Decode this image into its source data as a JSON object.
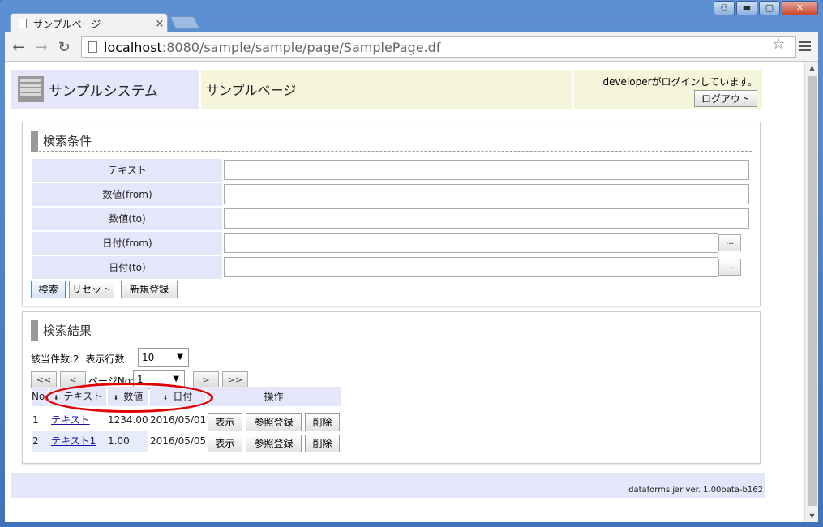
{
  "browser": {
    "tab_title": "サンプルページ",
    "close_glyph": "×",
    "url_host": "localhost",
    "url_path": ":8080/sample/sample/page/SamplePage.df",
    "window_buttons": [
      "⚇",
      "▬",
      "▢",
      "✕"
    ]
  },
  "header": {
    "system_name": "サンプルシステム",
    "page_name": "サンプルページ",
    "login_message": "developerがログインしています。",
    "logout_label": "ログアウト"
  },
  "search": {
    "title": "検索条件",
    "fields": [
      {
        "label": "テキスト",
        "value": ""
      },
      {
        "label": "数値(from)",
        "value": ""
      },
      {
        "label": "数値(to)",
        "value": ""
      },
      {
        "label": "日付(from)",
        "value": "",
        "picker": "..."
      },
      {
        "label": "日付(to)",
        "value": "",
        "picker": "..."
      }
    ],
    "buttons": {
      "search": "検索",
      "reset": "リセット",
      "new": "新規登録"
    }
  },
  "results": {
    "title": "検索結果",
    "count_label": "該当件数:2",
    "rows_label": "表示行数:",
    "rows_value": "10",
    "page_label": "ページNo:",
    "page_value": "1",
    "pager": {
      "first": "<<",
      "prev": "<",
      "next": ">",
      "last": ">>"
    },
    "columns": {
      "no": "No",
      "text": "テキスト",
      "number": "数値",
      "date": "日付",
      "ops": "操作"
    },
    "sort_glyph": "⬍",
    "rows": [
      {
        "no": "1",
        "text": "テキスト",
        "number": "1234.00",
        "date": "2016/05/01",
        "view": "表示",
        "ref": "参照登録",
        "del": "削除"
      },
      {
        "no": "2",
        "text": "テキスト1",
        "number": "1.00",
        "date": "2016/05/05",
        "view": "表示",
        "ref": "参照登録",
        "del": "削除"
      }
    ]
  },
  "footer": {
    "version": "dataforms.jar ver. 1.00bata-b162"
  },
  "colors": {
    "header_left": "#e6e6fa",
    "header_mid": "#f5f5dc",
    "annotation": "#e00000"
  }
}
